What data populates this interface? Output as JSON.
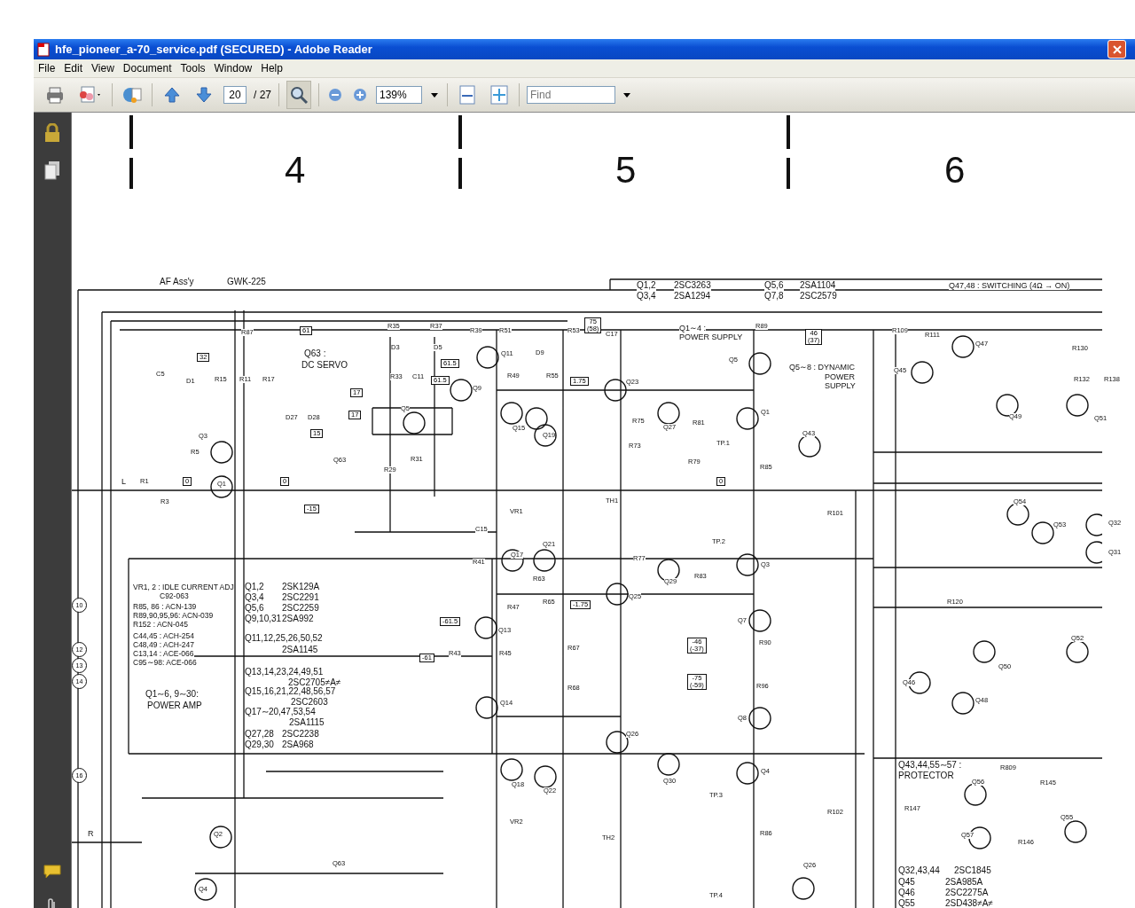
{
  "window": {
    "title": "hfe_pioneer_a-70_service.pdf (SECURED) - Adobe Reader"
  },
  "menu": [
    "File",
    "Edit",
    "View",
    "Document",
    "Tools",
    "Window",
    "Help"
  ],
  "toolbar": {
    "page_current": "20",
    "page_total": "/ 27",
    "zoom": "139%",
    "find_placeholder": "Find",
    "zoom_tool_selected": true
  },
  "document": {
    "column_numbers": [
      "4",
      "5",
      "6"
    ],
    "inputs": [
      "L",
      "R"
    ],
    "terminals": [
      "10",
      "12",
      "13",
      "14",
      "16"
    ],
    "tags": [
      {
        "text": "61"
      },
      {
        "text": "32"
      },
      {
        "text": "17"
      },
      {
        "text": "17"
      },
      {
        "text": "15"
      },
      {
        "text": "61.5"
      },
      {
        "text": "61.5"
      },
      {
        "text": "1.75"
      },
      {
        "text": "75\n(58)"
      },
      {
        "text": "46\n(37)"
      },
      {
        "text": "-15"
      },
      {
        "text": "-61.5"
      },
      {
        "text": "-61"
      },
      {
        "text": "-1.75"
      },
      {
        "text": "-46\n(-37)"
      },
      {
        "text": "-75\n(-59)"
      },
      {
        "text": "0"
      },
      {
        "text": "0"
      },
      {
        "text": "0"
      }
    ],
    "headings": [
      "AF Ass'y",
      "GWK-225",
      "Q47,48 : SWITCHING (4Ω → ON)",
      "Q63 :",
      "DC SERVO",
      "Q1∼4 :",
      "POWER SUPPLY",
      "Q5∼8 : DYNAMIC",
      "POWER",
      "SUPPLY",
      "Q1∼6, 9∼30:",
      "POWER AMP",
      "Q43,44,55∼57 :",
      "PROTECTOR"
    ],
    "notes": [
      "VR1, 2 : IDLE CURRENT ADJ",
      "C92-063",
      "R85, 86 : ACN-139",
      "R89,90,95,96: ACN-039",
      "R152 : ACN-045",
      "C44,45 : ACH-254",
      "C48,49 : ACH-247",
      "C13,14 : ACE-066",
      "C95∼98: ACE-066"
    ],
    "parts": [
      {
        "ref": "Q1,2",
        "part": "2SC3263"
      },
      {
        "ref": "Q3,4",
        "part": "2SA1294"
      },
      {
        "ref": "Q5,6",
        "part": "2SA1104"
      },
      {
        "ref": "Q7,8",
        "part": "2SC2579"
      },
      {
        "ref": "Q1,2",
        "part": "2SK129A"
      },
      {
        "ref": "Q3,4",
        "part": "2SC2291"
      },
      {
        "ref": "Q5,6",
        "part": "2SC2259"
      },
      {
        "ref": "Q9,10,31",
        "part": "2SA992"
      },
      {
        "ref": "Q11,12,25,26,50,52",
        "part": "2SA1145"
      },
      {
        "ref": "Q13,14,23,24,49,51",
        "part": "2SC2705≠A≠"
      },
      {
        "ref": "Q15,16,21,22,48,56,57",
        "part": "2SC2603"
      },
      {
        "ref": "Q17∼20,47,53,54",
        "part": "2SA1115"
      },
      {
        "ref": "Q27,28",
        "part": "2SC2238"
      },
      {
        "ref": "Q29,30",
        "part": "2SA968"
      },
      {
        "ref": "Q32,43,44",
        "part": "2SC1845"
      },
      {
        "ref": "Q45",
        "part": "2SA985A"
      },
      {
        "ref": "Q46",
        "part": "2SC2275A"
      },
      {
        "ref": "Q55",
        "part": "2SD438≠A≠"
      }
    ],
    "designators": [
      "Q11",
      "Q9",
      "Q5",
      "Q3",
      "Q1",
      "Q63",
      "Q15",
      "Q19",
      "Q23",
      "Q27",
      "Q1",
      "Q5",
      "Q43",
      "Q45",
      "Q47",
      "Q49",
      "Q51",
      "Q17",
      "Q21",
      "Q25",
      "Q29",
      "Q3",
      "Q7",
      "Q13",
      "Q14",
      "Q8",
      "Q26",
      "Q30",
      "Q4",
      "Q18",
      "Q22",
      "Q2",
      "Q4",
      "Q63",
      "Q54",
      "Q53",
      "Q32",
      "Q31",
      "Q50",
      "Q52",
      "Q46",
      "Q48",
      "Q56",
      "Q57",
      "Q55",
      "Q26",
      "TP.1",
      "TP.2",
      "TP.3",
      "TP.4",
      "TH1",
      "TH2",
      "VR1",
      "VR2",
      "R87",
      "R35",
      "R37",
      "R39",
      "R51",
      "R53",
      "R89",
      "R109",
      "R111",
      "R130",
      "R132",
      "R138",
      "R49",
      "R55",
      "R1",
      "R3",
      "R5",
      "R15",
      "R11",
      "R17",
      "R29",
      "R31",
      "R33",
      "C11",
      "C5",
      "C17",
      "C15",
      "R41",
      "R63",
      "R65",
      "R47",
      "R43",
      "R45",
      "R67",
      "R68",
      "R75",
      "R73",
      "R77",
      "R79",
      "R81",
      "R83",
      "R85",
      "R90",
      "R96",
      "R86",
      "R101",
      "R102",
      "R120",
      "R147",
      "R145",
      "R809",
      "R146",
      "D1",
      "D3",
      "D5",
      "D9",
      "D27",
      "D28"
    ]
  }
}
